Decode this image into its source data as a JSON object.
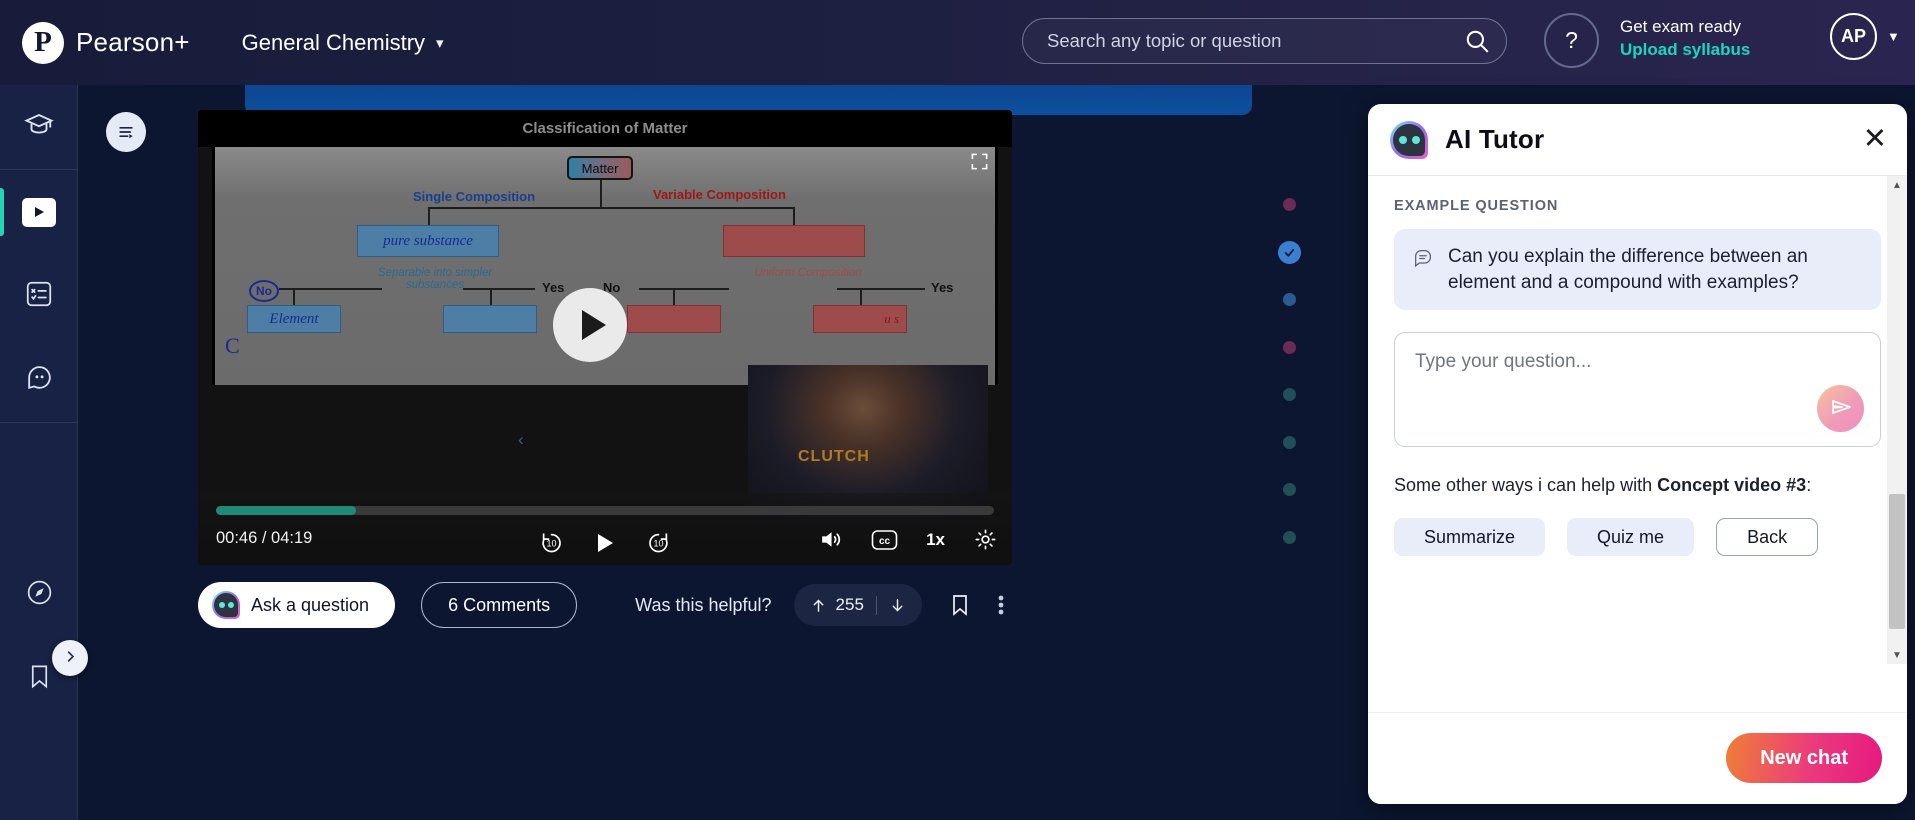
{
  "header": {
    "brand": "Pearson+",
    "logo_icon": "pearson-p-logo",
    "course": "General Chemistry",
    "course_caret_icon": "chevron-down-icon",
    "search_placeholder": "Search any topic or question",
    "search_icon": "search-icon",
    "help_label": "?",
    "exam_line1": "Get exam ready",
    "exam_line2": "Upload syllabus",
    "exam_link_color": "#1ad6c0",
    "avatar_initials": "AP",
    "avatar_caret_icon": "caret-down-icon"
  },
  "rail": {
    "items": [
      {
        "name": "courses",
        "icon": "graduation-cap-icon",
        "active": false
      },
      {
        "name": "videos",
        "icon": "video-play-icon",
        "active": true
      },
      {
        "name": "practice",
        "icon": "quiz-checklist-icon",
        "active": false
      },
      {
        "name": "discussion",
        "icon": "chat-bubble-icon",
        "active": false
      },
      {
        "name": "explore",
        "icon": "compass-icon",
        "active": false
      },
      {
        "name": "bookmarks",
        "icon": "bookmark-icon",
        "active": false
      }
    ],
    "expand_icon": "chevron-right-icon",
    "active_indicator_color": "#27d3b6"
  },
  "main": {
    "outline_toggle_icon": "transcript-outline-icon",
    "video": {
      "title": "Classification of Matter",
      "fullscreen_icon": "fullscreen-icon",
      "play_overlay_icon": "play-icon",
      "time_display": "00:46 / 04:19",
      "progress_percent": 18,
      "controls": {
        "rewind": "10",
        "play_icon": "play-icon",
        "forward": "10",
        "volume_icon": "volume-icon",
        "cc_icon": "closed-caption-icon",
        "speed": "1x",
        "settings_icon": "gear-icon"
      },
      "brand_watermark": "CLUTCH",
      "diagram": {
        "root": "Matter",
        "left_branch_label": "Single Composition",
        "right_branch_label": "Variable Composition",
        "left_node_handwritten": "pure substance",
        "left_question": "Separable into simpler substances",
        "right_question": "Uniform Composition",
        "left_no": "No",
        "left_yes": "Yes",
        "right_no": "No",
        "right_yes": "Yes",
        "leaf_handwritten": "Element",
        "leaf_handwritten2": "C",
        "leaf_handwritten_right": "u s"
      }
    },
    "actions": {
      "ask_label": "Ask a question",
      "ask_icon": "ai-bot-icon",
      "comments_label": "6 Comments",
      "helpful_label": "Was this helpful?",
      "upvote_icon": "arrow-up-icon",
      "upvote_count": "255",
      "downvote_icon": "arrow-down-icon",
      "bookmark_icon": "bookmark-icon",
      "more_icon": "more-vertical-icon"
    },
    "progress_dots": [
      {
        "color": "#6b2a57",
        "state": "purple"
      },
      {
        "color": "#3c7fd0",
        "state": "current-complete"
      },
      {
        "color": "#2a5c92",
        "state": "blue"
      },
      {
        "color": "#6b2a57",
        "state": "purple"
      },
      {
        "color": "#1f5059",
        "state": "teal"
      },
      {
        "color": "#1f5059",
        "state": "teal"
      },
      {
        "color": "#1f5059",
        "state": "teal"
      },
      {
        "color": "#1f5059",
        "state": "teal"
      }
    ],
    "check_icon": "check-icon"
  },
  "tutor": {
    "title": "AI Tutor",
    "bot_icon": "ai-bot-icon",
    "close_icon": "close-icon",
    "example_label": "EXAMPLE QUESTION",
    "example_icon": "chat-lines-icon",
    "example_question": "Can you explain the difference between an element and a compound with examples?",
    "input_placeholder": "Type your question...",
    "send_icon": "send-plane-icon",
    "other_ways_prefix": "Some other ways i can help with ",
    "other_ways_bold": "Concept video #3",
    "other_ways_suffix": ":",
    "suggestions": [
      {
        "label": "Summarize",
        "style": "filled"
      },
      {
        "label": "Quiz me",
        "style": "filled"
      },
      {
        "label": "Back",
        "style": "outline"
      }
    ],
    "new_chat_label": "New chat",
    "scroll_up_icon": "triangle-up-icon",
    "scroll_down_icon": "triangle-down-icon"
  }
}
